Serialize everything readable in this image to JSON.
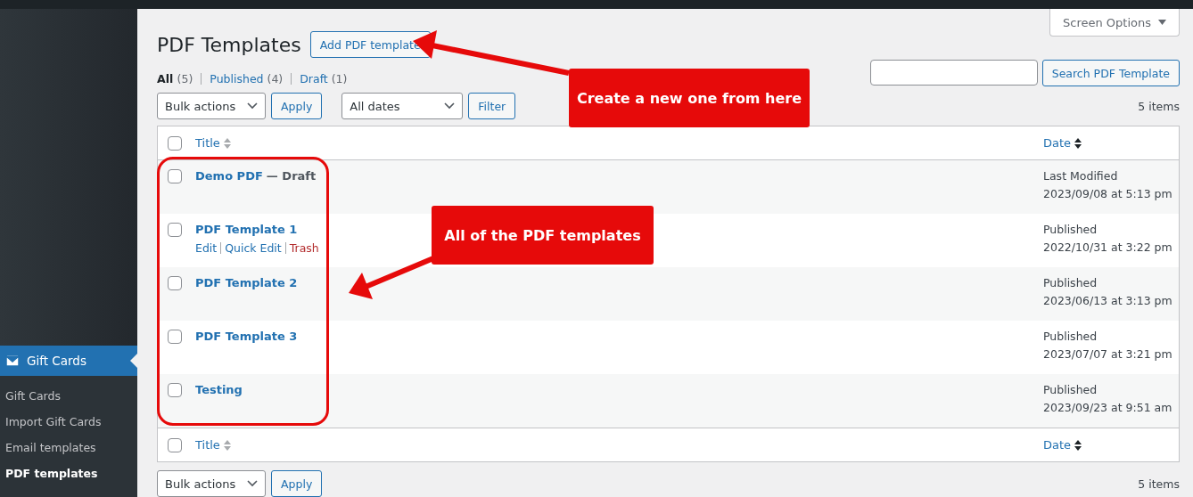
{
  "sidebar": {
    "menu": {
      "label": "Gift Cards",
      "selected": true
    },
    "items": [
      {
        "label": "Gift Cards",
        "selected": false
      },
      {
        "label": "Import Gift Cards",
        "selected": false
      },
      {
        "label": "Email templates",
        "selected": false
      },
      {
        "label": "PDF templates",
        "selected": true
      }
    ]
  },
  "screen_options": "Screen Options",
  "page_title": "PDF Templates",
  "add_button": "Add PDF template",
  "filters": [
    {
      "label": "All",
      "count": "(5)",
      "selected": true
    },
    {
      "label": "Published",
      "count": "(4)",
      "selected": false
    },
    {
      "label": "Draft",
      "count": "(1)",
      "selected": false
    }
  ],
  "search_button": "Search PDF Template",
  "top_controls": {
    "bulk": "Bulk actions",
    "apply": "Apply",
    "dates": "All dates",
    "filter": "Filter",
    "count": "5 items"
  },
  "header": {
    "select_all_checked": false,
    "columns": [
      {
        "label": "Title",
        "sorted": false
      },
      {
        "label": "Date",
        "sorted": true
      }
    ]
  },
  "footer": {
    "select_all_checked": false,
    "columns": [
      {
        "label": "Title",
        "sorted": false
      },
      {
        "label": "Date",
        "sorted": true
      }
    ]
  },
  "rows": [
    {
      "title": "Demo PDF",
      "state_label": "— Draft",
      "checked": false,
      "status": "Last Modified",
      "date": "2023/09/08 at 5:13 pm"
    },
    {
      "title": "PDF Template 1",
      "checked": false,
      "status": "Published",
      "date": "2022/10/31 at 3:22 pm",
      "actions": [
        {
          "label": "Edit",
          "kind": "link"
        },
        {
          "label": "Quick Edit",
          "kind": "link"
        },
        {
          "label": "Trash",
          "kind": "delete"
        }
      ]
    },
    {
      "title": "PDF Template 2",
      "checked": false,
      "status": "Published",
      "date": "2023/06/13 at 3:13 pm"
    },
    {
      "title": "PDF Template 3",
      "checked": false,
      "status": "Published",
      "date": "2023/07/07 at 3:21 pm"
    },
    {
      "title": "Testing",
      "checked": false,
      "status": "Published",
      "date": "2023/09/23 at 9:51 am"
    }
  ],
  "bottom_controls": {
    "bulk": "Bulk actions",
    "apply": "Apply",
    "count": "5 items"
  },
  "annotations": [
    {
      "text": "Create a new one from here"
    },
    {
      "text": "All of the PDF templates"
    }
  ]
}
